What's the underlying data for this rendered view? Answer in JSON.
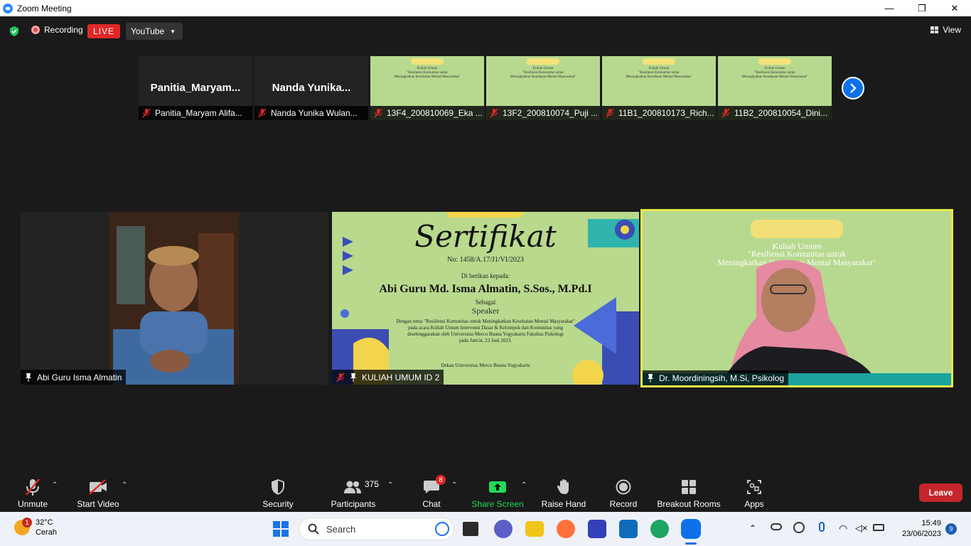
{
  "window": {
    "title": "Zoom Meeting",
    "minimize": "—",
    "maximize": "❐",
    "close": "✕"
  },
  "topbar": {
    "recording": "Recording",
    "live": "LIVE",
    "stream": "YouTube",
    "view": "View"
  },
  "thumbnails": [
    {
      "big_name": "Panitia_Maryam...",
      "label": "Panitia_Maryam Alifa...",
      "type": "name"
    },
    {
      "big_name": "Nanda  Yunika...",
      "label": "Nanda Yunika Wulan...",
      "type": "name"
    },
    {
      "label": "13F4_200810069_Eka ...",
      "type": "slide"
    },
    {
      "label": "13F2_200810074_Puji ...",
      "type": "slide"
    },
    {
      "label": "11B1_200810173_Rich...",
      "type": "slide"
    },
    {
      "label": "11B2_200810054_Dini...",
      "type": "slide"
    }
  ],
  "thumb_slide_text": "Kuliah Umum\n\"Resiliensi Komunitas untuk\nMeningkatkan Kesehatan Mental Masyarakat\"",
  "tiles": {
    "speaker1": {
      "label": "Abi Guru Isma Almatin"
    },
    "certificate": {
      "label": "KULIAH UMUM ID 2",
      "title": "Sertifikat",
      "number": "No: 1458/A.17/J1/VI/2023",
      "given_to": "Di berikan kepada:",
      "name": "Abi Guru Md. Isma Almatin, S.Sos., M.Pd.I",
      "as": "Sebagai",
      "role": "Speaker",
      "body1": "Dengan tema \"Resiliensi Komunitas untuk Meningkatkan Kesehatan Mental Masyarakat\"",
      "body2": "pada acara Kuliah Umum Intervensi Dasar & Kelompok dan Komunitas yang",
      "body3": "diselenggarakan oleh Universitas Mercu Buana Yogyakarta Fakultas Psikologi",
      "body4": "pada Jum'at, 23 Juni 2023.",
      "dean": "Dekan Universitas Mercu Buana Yogyakarta"
    },
    "speaker2": {
      "label": "Dr. Moordiningsih, M.Si, Psikolog",
      "slide_title": "Kuliah Umum",
      "slide_sub1": "\"Resiliensi Komunitas untuk",
      "slide_sub2": "Meningkatkan Kesehatan Mental Masyarakat\""
    }
  },
  "toolbar": {
    "unmute": "Unmute",
    "start_video": "Start Video",
    "security": "Security",
    "participants": "Participants",
    "participants_count": "375",
    "chat": "Chat",
    "chat_badge": "8",
    "share_screen": "Share Screen",
    "raise_hand": "Raise Hand",
    "record": "Record",
    "breakout": "Breakout Rooms",
    "apps": "Apps",
    "leave": "Leave"
  },
  "taskbar": {
    "temp": "32°C",
    "weather": "Cerah",
    "weather_badge": "1",
    "search": "Search",
    "time": "15:49",
    "date": "23/06/2023",
    "notifications": "9"
  },
  "colors": {
    "accent": "#0e71eb",
    "live": "#e02828",
    "leave": "#c4262b",
    "share": "#23d959",
    "active_speaker": "#e8e84a"
  }
}
